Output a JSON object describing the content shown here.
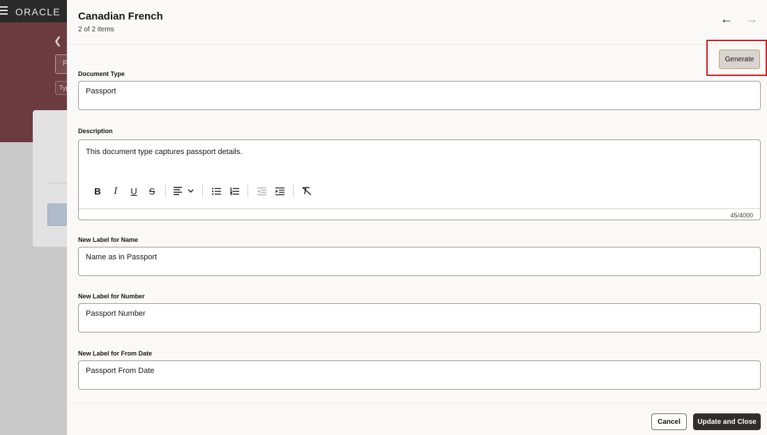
{
  "background": {
    "logo": "ORACLE",
    "search_stub": "P",
    "chip_stub": "Typ"
  },
  "drawer": {
    "title": "Canadian French",
    "subtitle": "2 of 2 items"
  },
  "generate_label": "Generate",
  "fields": {
    "document_type": {
      "label": "Document Type",
      "value": "Passport"
    },
    "description": {
      "label": "Description",
      "value": "This document type captures passport details.",
      "count": "45/4000"
    },
    "name_label": {
      "label": "New Label for Name",
      "value": "Name as in Passport"
    },
    "number_label": {
      "label": "New Label for Number",
      "value": "Passport Number"
    },
    "from_date_label": {
      "label": "New Label for From Date",
      "value": "Passport From Date"
    }
  },
  "footer": {
    "cancel": "Cancel",
    "primary": "Update and Close"
  },
  "colors": {
    "brand_band": "#6b3b40",
    "primary_button": "#312d2a",
    "highlight": "#d51b20"
  }
}
